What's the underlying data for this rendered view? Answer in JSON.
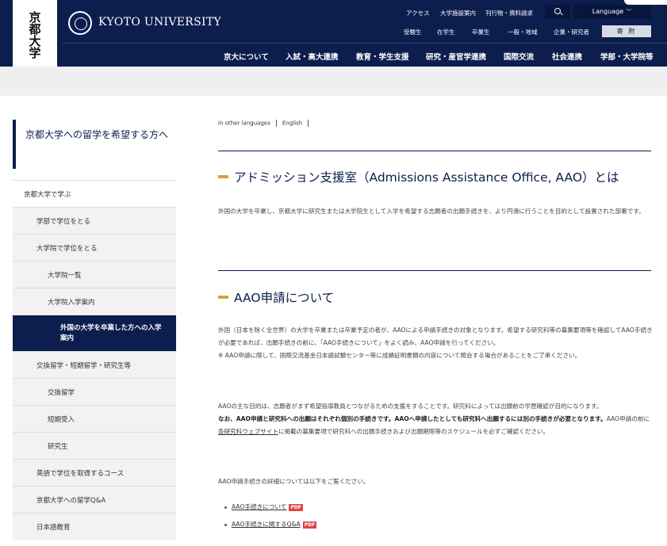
{
  "header": {
    "logo_vertical": "京都大学",
    "university_name": "KYOTO UNIVERSITY",
    "top_links": [
      "アクセス",
      "大学施設案内",
      "刊行物・資料請求"
    ],
    "language_label": "Language",
    "sub_links": [
      "受験生",
      "在学生",
      "卒業生",
      "一般・地域",
      "企業・研究者"
    ],
    "donate_label": "寄 附",
    "main_nav": [
      "京大について",
      "入試・高大連携",
      "教育・学生支援",
      "研究・産官学連携",
      "国際交流",
      "社会連携",
      "学部・大学院等"
    ]
  },
  "sidebar": {
    "title": "京都大学への留学を希望する方へ",
    "items": [
      {
        "label": "京都大学で学ぶ",
        "level": 0
      },
      {
        "label": "学部で学位をとる",
        "level": 1
      },
      {
        "label": "大学院で学位をとる",
        "level": 1
      },
      {
        "label": "大学院一覧",
        "level": 2
      },
      {
        "label": "大学院入学案内",
        "level": 2
      },
      {
        "label": "外国の大学を卒業した方への入学案内",
        "level": 3,
        "active": true
      },
      {
        "label": "交換留学・短期留学・研究生等",
        "level": 1
      },
      {
        "label": "交換留学",
        "level": 2
      },
      {
        "label": "短期受入",
        "level": 2
      },
      {
        "label": "研究生",
        "level": 2
      },
      {
        "label": "英語で学位を取得するコース",
        "level": 1
      },
      {
        "label": "京都大学への留学Q&A",
        "level": 1
      },
      {
        "label": "日本語教育",
        "level": 1
      }
    ]
  },
  "main": {
    "other_languages_label": "In other languages",
    "language_link": "English",
    "section1": {
      "heading": "アドミッション支援室（Admissions Assistance Office, AAO）とは",
      "body": "外国の大学を卒業し、京都大学に研究生または大学院生として入学を希望する志願者の出願手続きを、より円滑に行うことを目的として設置された部署です。"
    },
    "section2": {
      "heading": "AAO申請について",
      "para1": "外国（日本を除く全世界）の大学を卒業または卒業予定の者が、AAOによる申請手続きの対象となります。希望する研究科等の募集要項等を確認してAAO手続きが必要であれば、出願手続きの前に、「AAO手続きについて」をよく読み、AAO申請を行ってください。",
      "para1_note": "※ AAO申請に際して、国際交流基金日本語試験センター等に成績証明書類の内容について照会する場合があることをご了承ください。",
      "para2_start": "AAOの主な目的は、志願者がまず希望指導教員とつながるための支援をすることです。研究科によっては出願前の学歴確認が目的になります。",
      "para2_bold": "なお、AAO申請と研究科への出願はそれぞれ個別の手続きです。AAOへ申請したとしても研究科へ出願するには別の手続きが必要となります。",
      "para2_pre_link": "AAO申請の前に",
      "para2_link": "各研究科ウェブサイト",
      "para2_post_link": "に掲載の募集要項で研究科への出願手続きおよび出願期限等のスケジュールを必ずご確認ください。",
      "para3": "AAO申請手続きの詳細については以下をご覧ください。",
      "links": [
        {
          "label": "AAO手続きについて",
          "badge": "PDF"
        },
        {
          "label": "AAO手続きに関するQ&A",
          "badge": "PDF"
        }
      ]
    }
  },
  "colors": {
    "navy": "#0c1e4e",
    "accent_gold": "#d4a33a",
    "pdf_red": "#e04545"
  }
}
